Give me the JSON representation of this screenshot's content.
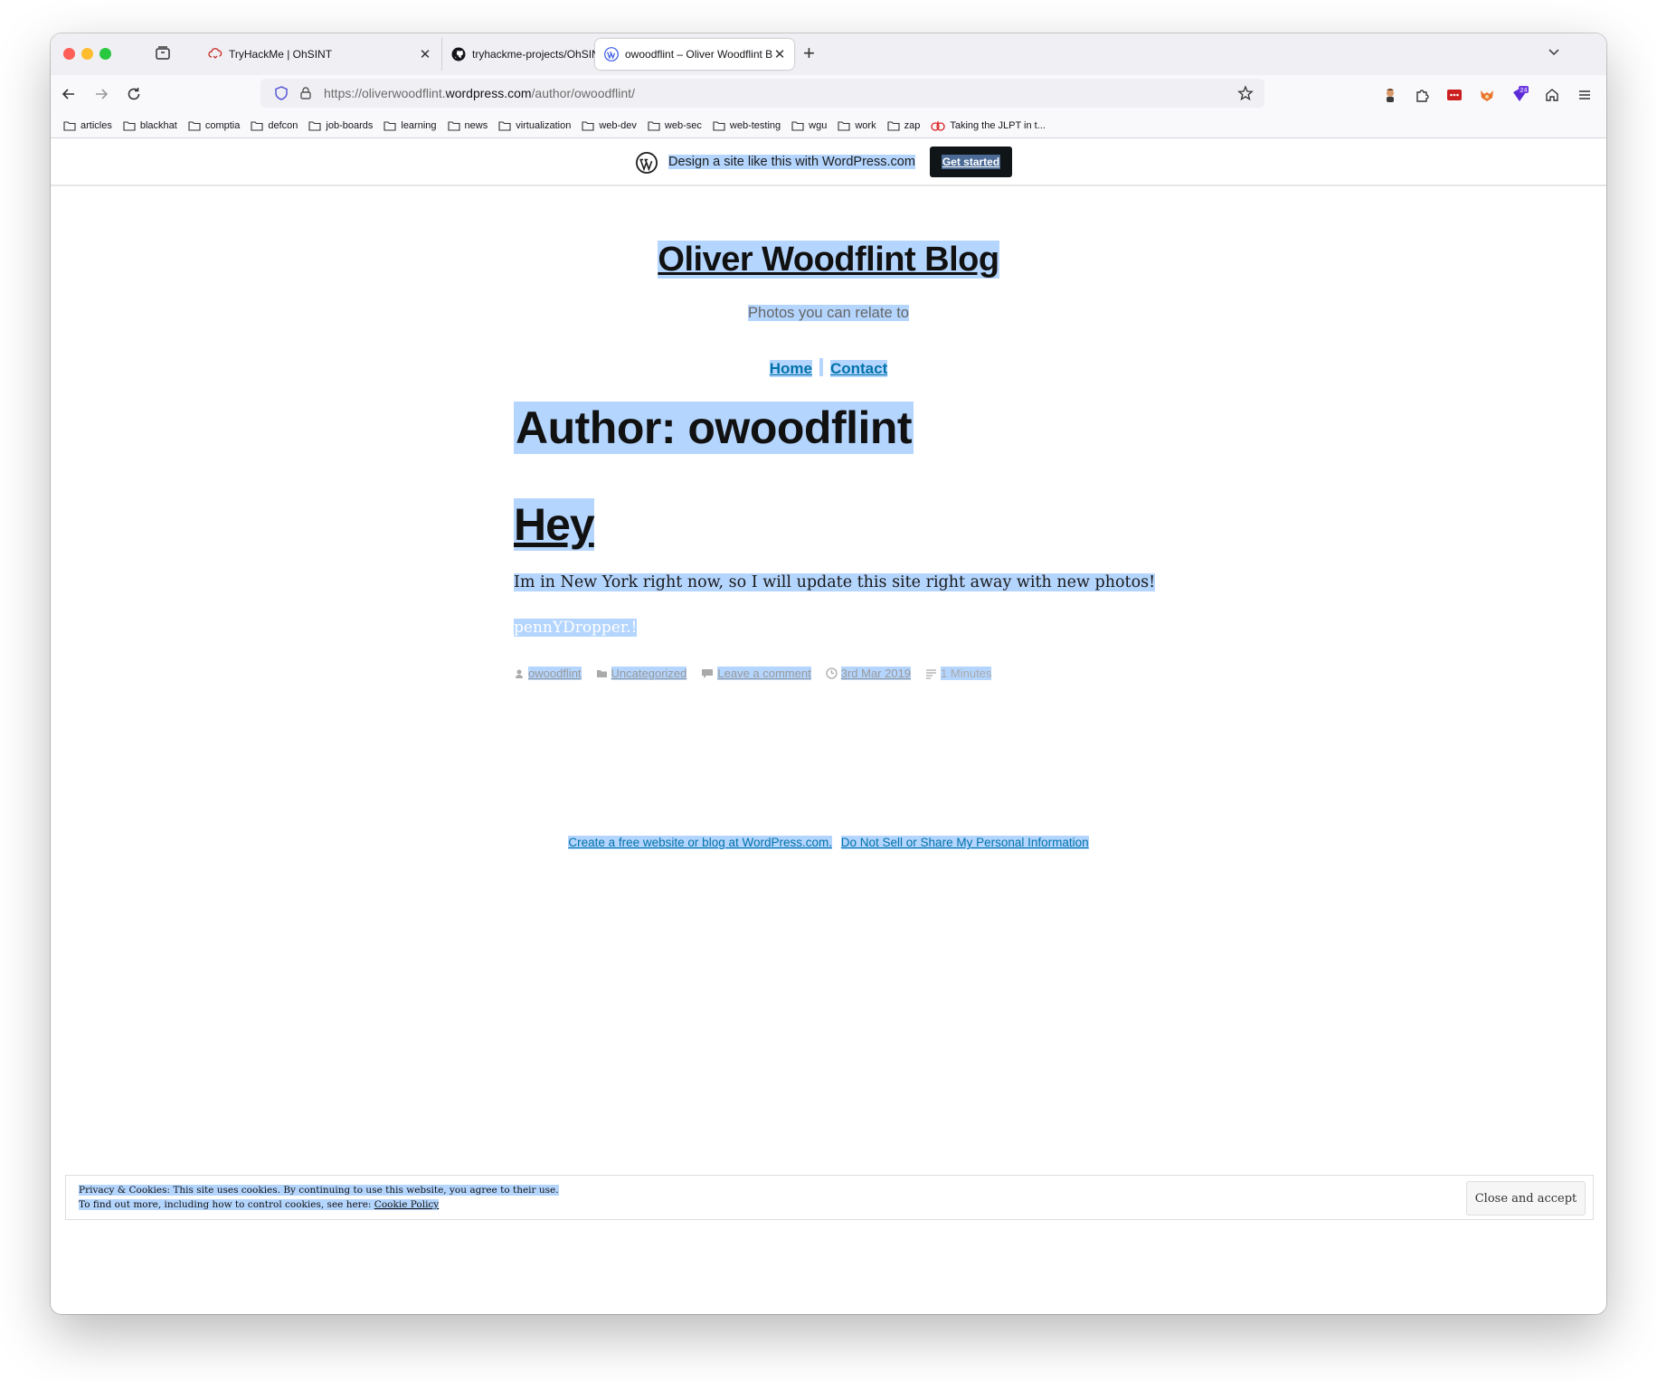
{
  "browser": {
    "tabs": [
      {
        "label": "TryHackMe | OhSINT",
        "icon": "tryhackme-icon"
      },
      {
        "label": "tryhackme-projects/OhSINT/Oh",
        "icon": "github-icon"
      },
      {
        "label": "owoodflint – Oliver Woodflint Bl",
        "icon": "wordpress-icon",
        "active": true
      }
    ],
    "url_prefix": "https://oliverwoodflint.",
    "url_host": "wordpress.com",
    "url_path": "/author/owoodflint/",
    "extension_badge": "24"
  },
  "bookmarks": [
    {
      "label": "articles"
    },
    {
      "label": "blackhat"
    },
    {
      "label": "comptia"
    },
    {
      "label": "defcon"
    },
    {
      "label": "job-boards"
    },
    {
      "label": "learning"
    },
    {
      "label": "news"
    },
    {
      "label": "virtualization"
    },
    {
      "label": "web-dev"
    },
    {
      "label": "web-sec"
    },
    {
      "label": "web-testing"
    },
    {
      "label": "wgu"
    },
    {
      "label": "work"
    },
    {
      "label": "zap"
    },
    {
      "label": "Taking the JLPT in t..."
    }
  ],
  "wp_banner": {
    "text": "Design a site like this with WordPress.com",
    "button": "Get started"
  },
  "site": {
    "title": "Oliver Woodflint Blog",
    "description": "Photos you can relate to",
    "nav": [
      "Home",
      "Contact"
    ]
  },
  "archive": {
    "page_title": "Author: owoodflint",
    "post": {
      "title": "Hey",
      "body": "Im in New York right now, so I will update this site right away with new photos!",
      "hidden_text": "pennYDropper.!",
      "meta": {
        "author": "owoodflint",
        "category": "Uncategorized",
        "comments": "Leave a comment",
        "date": "3rd Mar 2019",
        "read_time": "1 Minutes"
      }
    }
  },
  "footer": {
    "link1": "Create a free website or blog at WordPress.com.",
    "link2": "Do Not Sell or Share My Personal Information"
  },
  "cookie_notice": {
    "line1": "Privacy & Cookies: This site uses cookies. By continuing to use this website, you agree to their use.",
    "line2_prefix": "To find out more, including how to control cookies, see here: ",
    "policy_link": "Cookie Policy",
    "button": "Close and accept"
  },
  "colors": {
    "link": "#0073aa",
    "selection": "#b4d5fe",
    "banner_button": "#101517"
  }
}
